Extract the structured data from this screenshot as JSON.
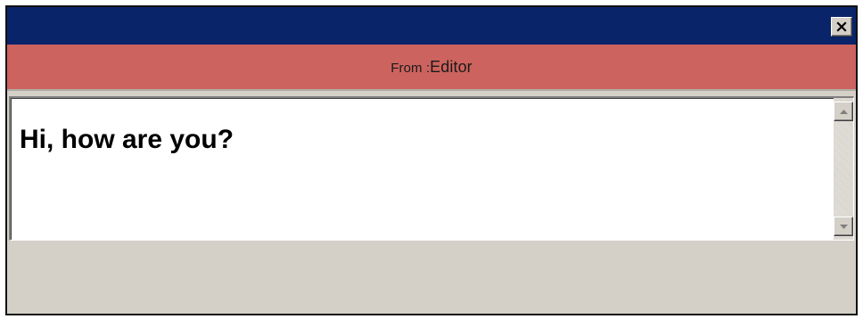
{
  "window": {
    "titlebar_color": "#0a246a",
    "close_icon": "close-icon"
  },
  "header": {
    "from_label": "From :",
    "sender": "Editor",
    "band_color": "#cd635e"
  },
  "message": {
    "text": "Hi, how are you?"
  },
  "scrollbar": {
    "up_icon": "arrow-up-icon",
    "down_icon": "arrow-down-icon"
  }
}
